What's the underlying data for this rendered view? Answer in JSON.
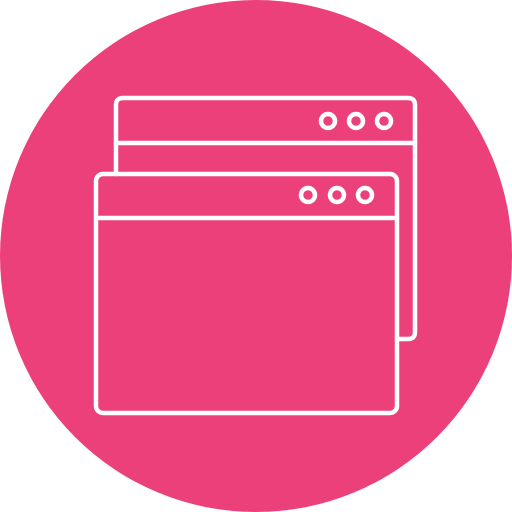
{
  "icon": {
    "name": "browser-windows-icon",
    "background_color": "#EC407A",
    "stroke_color": "#FFFFFF"
  }
}
